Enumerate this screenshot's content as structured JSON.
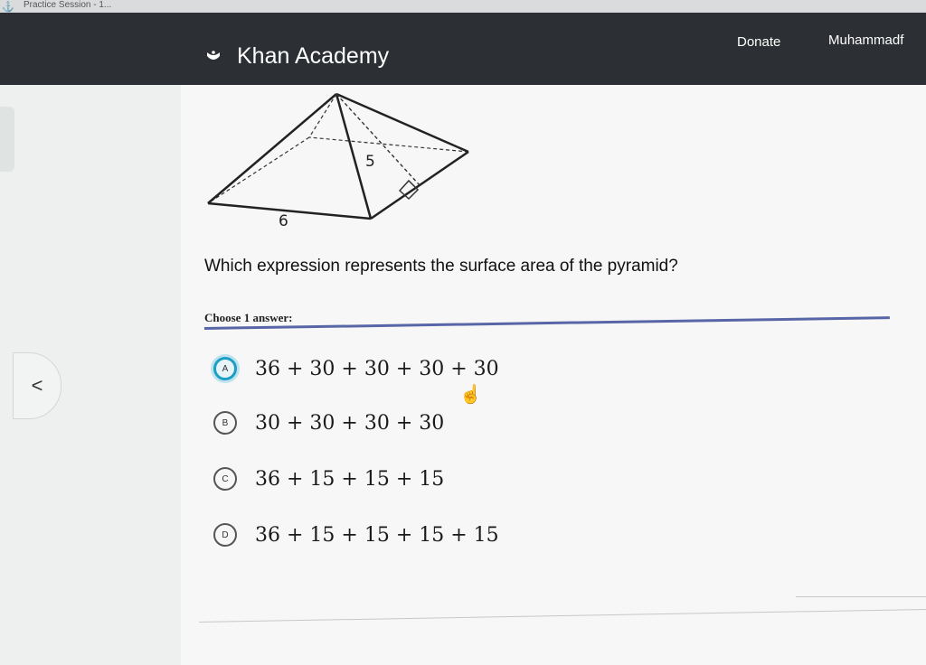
{
  "browser": {
    "tab_title": "Practice Session - 1..."
  },
  "header": {
    "logo_text": "Khan Academy",
    "donate_label": "Donate",
    "user_name": "Muhammadf",
    "logo_icon": "khan-leaf-icon"
  },
  "figure": {
    "base_label": "6",
    "slant_label": "5"
  },
  "question": {
    "text": "Which expression represents the surface area of the pyramid?",
    "choose_label": "Choose 1 answer:"
  },
  "choices": [
    {
      "letter": "A",
      "text": "36 + 30 + 30 + 30 + 30",
      "selected": true
    },
    {
      "letter": "B",
      "text": "30 + 30 + 30 + 30",
      "selected": false
    },
    {
      "letter": "C",
      "text": "36 + 15 + 15 + 15",
      "selected": false
    },
    {
      "letter": "D",
      "text": "36 + 15 + 15 + 15 + 15",
      "selected": false
    }
  ],
  "nav": {
    "back_symbol": "<"
  },
  "colors": {
    "header_bg": "#2c2f33",
    "accent": "#1c9fc4",
    "divider": "#5866a8"
  }
}
